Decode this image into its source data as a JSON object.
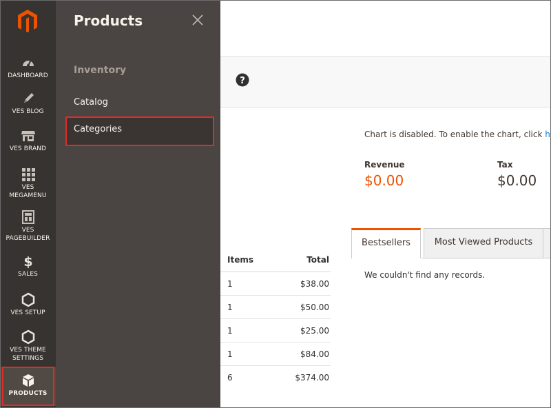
{
  "nav": {
    "items": [
      {
        "label": "DASHBOARD",
        "icon": "gauge-icon"
      },
      {
        "label": "VES BLOG",
        "icon": "pencil-icon"
      },
      {
        "label": "VES BRAND",
        "icon": "store-icon"
      },
      {
        "label_line1": "VES",
        "label_line2": "MEGAMENU",
        "icon": "grid-icon"
      },
      {
        "label_line1": "VES",
        "label_line2": "PAGEBUILDER",
        "icon": "layout-icon"
      },
      {
        "label": "SALES",
        "icon": "dollar-icon"
      },
      {
        "label": "VES SETUP",
        "icon": "hexagon-icon"
      },
      {
        "label_line1": "VES THEME",
        "label_line2": "SETTINGS",
        "icon": "hexagon-icon"
      },
      {
        "label": "PRODUCTS",
        "icon": "cube-icon"
      }
    ]
  },
  "submenu": {
    "title": "Products",
    "section": "Inventory",
    "links": [
      "Catalog",
      "Categories"
    ]
  },
  "dashboard": {
    "chart_message": "Chart is disabled. To enable the chart, click ",
    "chart_link": "here",
    "revenue_label": "Revenue",
    "revenue_value": "$0.00",
    "tax_label": "Tax",
    "tax_value": "$0.00"
  },
  "orders": {
    "headers": [
      "Items",
      "Total"
    ],
    "rows": [
      {
        "items": "1",
        "total": "$38.00"
      },
      {
        "items": "1",
        "total": "$50.00"
      },
      {
        "items": "1",
        "total": "$25.00"
      },
      {
        "items": "1",
        "total": "$84.00"
      },
      {
        "items": "6",
        "total": "$374.00"
      }
    ]
  },
  "tabs": {
    "items": [
      "Bestsellers",
      "Most Viewed Products"
    ],
    "empty_message": "We couldn't find any records."
  },
  "colors": {
    "nav_bg": "#373330",
    "submenu_bg": "#4a4542",
    "accent": "#eb5202",
    "highlight": "#e02b27",
    "link": "#007bdb"
  }
}
